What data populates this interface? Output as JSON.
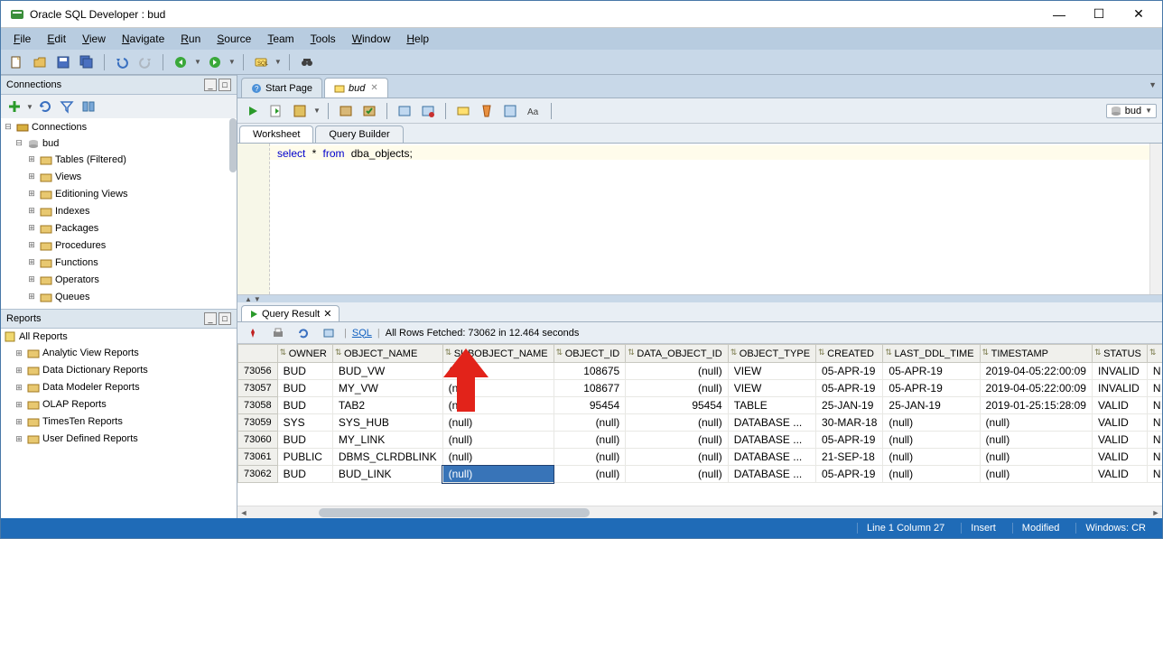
{
  "window": {
    "title": "Oracle SQL Developer : bud"
  },
  "menu": [
    "File",
    "Edit",
    "View",
    "Navigate",
    "Run",
    "Source",
    "Team",
    "Tools",
    "Window",
    "Help"
  ],
  "left": {
    "connections_label": "Connections",
    "reports_label": "Reports",
    "tree_root": "Connections",
    "conn_name": "bud",
    "conn_children": [
      "Tables (Filtered)",
      "Views",
      "Editioning Views",
      "Indexes",
      "Packages",
      "Procedures",
      "Functions",
      "Operators",
      "Queues"
    ],
    "reports_root": "All Reports",
    "reports_children": [
      "Analytic View Reports",
      "Data Dictionary Reports",
      "Data Modeler Reports",
      "OLAP Reports",
      "TimesTen Reports",
      "User Defined Reports"
    ]
  },
  "tabs": {
    "start": "Start Page",
    "file": "bud"
  },
  "ws_tabs": {
    "worksheet": "Worksheet",
    "qb": "Query Builder"
  },
  "sql": {
    "kw1": "select",
    "star": "*",
    "kw2": "from",
    "obj": "dba_objects",
    "semi": ";"
  },
  "conn_chooser": "bud",
  "qr": {
    "tab": "Query Result",
    "sql_link": "SQL",
    "status": "All Rows Fetched: 73062 in 12.464 seconds",
    "columns": [
      "",
      "OWNER",
      "OBJECT_NAME",
      "SUBOBJECT_NAME",
      "OBJECT_ID",
      "DATA_OBJECT_ID",
      "OBJECT_TYPE",
      "CREATED",
      "LAST_DDL_TIME",
      "TIMESTAMP",
      "STATUS",
      ""
    ],
    "rows": [
      {
        "n": "73056",
        "owner": "BUD",
        "oname": "BUD_VW",
        "sub": "(null)",
        "oid": "108675",
        "doid": "(null)",
        "otype": "VIEW",
        "created": "05-APR-19",
        "ddl": "05-APR-19",
        "ts": "2019-04-05:22:00:09",
        "status": "INVALID",
        "t": "N"
      },
      {
        "n": "73057",
        "owner": "BUD",
        "oname": "MY_VW",
        "sub": "(null)",
        "oid": "108677",
        "doid": "(null)",
        "otype": "VIEW",
        "created": "05-APR-19",
        "ddl": "05-APR-19",
        "ts": "2019-04-05:22:00:09",
        "status": "INVALID",
        "t": "N"
      },
      {
        "n": "73058",
        "owner": "BUD",
        "oname": "TAB2",
        "sub": "(null)",
        "oid": "95454",
        "doid": "95454",
        "otype": "TABLE",
        "created": "25-JAN-19",
        "ddl": "25-JAN-19",
        "ts": "2019-01-25:15:28:09",
        "status": "VALID",
        "t": "N"
      },
      {
        "n": "73059",
        "owner": "SYS",
        "oname": "SYS_HUB",
        "sub": "(null)",
        "oid": "(null)",
        "doid": "(null)",
        "otype": "DATABASE ...",
        "created": "30-MAR-18",
        "ddl": "(null)",
        "ts": "(null)",
        "status": "VALID",
        "t": "N"
      },
      {
        "n": "73060",
        "owner": "BUD",
        "oname": "MY_LINK",
        "sub": "(null)",
        "oid": "(null)",
        "doid": "(null)",
        "otype": "DATABASE ...",
        "created": "05-APR-19",
        "ddl": "(null)",
        "ts": "(null)",
        "status": "VALID",
        "t": "N"
      },
      {
        "n": "73061",
        "owner": "PUBLIC",
        "oname": "DBMS_CLRDBLINK",
        "sub": "(null)",
        "oid": "(null)",
        "doid": "(null)",
        "otype": "DATABASE ...",
        "created": "21-SEP-18",
        "ddl": "(null)",
        "ts": "(null)",
        "status": "VALID",
        "t": "N"
      },
      {
        "n": "73062",
        "owner": "BUD",
        "oname": "BUD_LINK",
        "sub": "(null)",
        "oid": "(null)",
        "doid": "(null)",
        "otype": "DATABASE ...",
        "created": "05-APR-19",
        "ddl": "(null)",
        "ts": "(null)",
        "status": "VALID",
        "t": "N"
      }
    ],
    "selected_row": 6,
    "selected_col": "sub"
  },
  "status": {
    "pos": "Line 1 Column 27",
    "ins": "Insert",
    "mod": "Modified",
    "enc": "Windows: CR"
  }
}
